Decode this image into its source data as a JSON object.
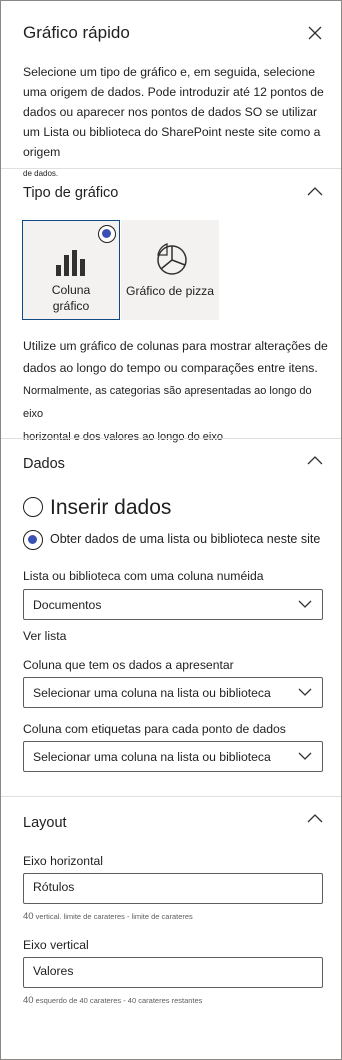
{
  "header": {
    "title": "Gráfico rápido",
    "intro_main": "Selecione um tipo de gráfico e, em seguida, selecione uma origem de dados. Pode introduzir até 12 pontos de dados ou aparecer nos pontos de dados SO se utilizar um Lista ou biblioteca do SharePoint neste site como a origem",
    "intro_tail": "de dados."
  },
  "chart_type": {
    "section_title": "Tipo de gráfico",
    "tiles": [
      {
        "label": "Coluna gráfico",
        "line1": "Coluna",
        "line2": "gráfico",
        "selected": true,
        "icon": "column-chart-icon"
      },
      {
        "label": "Gráfico de pizza",
        "selected": false,
        "icon": "pie-chart-icon"
      }
    ],
    "description_line1": "Utilize um gráfico de colunas para mostrar alterações de dados ao longo do tempo ou comparações entre itens.",
    "description_line2": "Normalmente, as categorias são apresentadas ao longo do eixo",
    "description_line3": "horizontal e dos valores ao longo do eixo"
  },
  "data": {
    "section_title": "Dados",
    "option_enter": "Inserir dados",
    "option_list": "Obter dados de uma lista ou biblioteca neste site",
    "selected_option": "option_list",
    "list_label": "Lista ou biblioteca com uma coluna numéida",
    "list_value": "Documentos",
    "view_list": "Ver lista",
    "data_column_label": "Coluna que tem os dados a apresentar",
    "data_column_value": "Selecionar uma coluna na lista ou biblioteca",
    "label_column_label": "Coluna com etiquetas para cada ponto de dados",
    "label_column_value": "Selecionar uma coluna na lista ou biblioteca"
  },
  "layout": {
    "section_title": "Layout",
    "horizontal_label": "Eixo horizontal",
    "horizontal_value": "Rótulos",
    "horizontal_hint_num": "40",
    "horizontal_hint_text": "vertical. limite de carateres - limite de carateres",
    "vertical_label": "Eixo vertical",
    "vertical_value": "Valores",
    "vertical_hint_num": "40",
    "vertical_hint_text": "esquerdo de 40 carateres - 40 carateres restantes"
  },
  "colors": {
    "accent": "#3c50b4",
    "selected_border": "#0f4a85",
    "tile_bg": "#f3f2f1",
    "divider": "#e1dfdd"
  }
}
